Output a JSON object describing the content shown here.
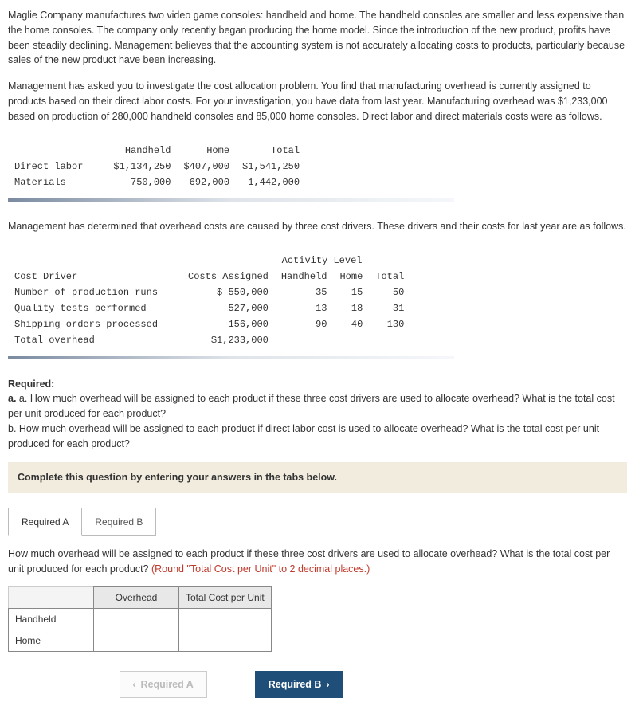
{
  "intro": {
    "p1": "Maglie Company manufactures two video game consoles: handheld and home. The handheld consoles are smaller and less expensive than the home consoles. The company only recently began producing the home model. Since the introduction of the new product, profits have been steadily declining. Management believes that the accounting system is not accurately allocating costs to products, particularly because sales of the new product have been increasing.",
    "p2": "Management has asked you to investigate the cost allocation problem. You find that manufacturing overhead is currently assigned to products based on their direct labor costs. For your investigation, you have data from last year. Manufacturing overhead was $1,233,000 based on production of 280,000 handheld consoles and 85,000 home consoles. Direct labor and direct materials costs were as follows."
  },
  "table1": {
    "headers": {
      "c1": "Handheld",
      "c2": "Home",
      "c3": "Total"
    },
    "rows": [
      {
        "label": "Direct labor",
        "handheld": "$1,134,250",
        "home": "$407,000",
        "total": "$1,541,250"
      },
      {
        "label": "Materials",
        "handheld": "750,000",
        "home": "692,000",
        "total": "1,442,000"
      }
    ]
  },
  "mid": "Management has determined that overhead costs are caused by three cost drivers. These drivers and their costs for last year are as follows.",
  "table2": {
    "superheader": "Activity Level",
    "headers": {
      "driver": "Cost Driver",
      "costs": "Costs Assigned",
      "hh": "Handheld",
      "home": "Home",
      "total": "Total"
    },
    "rows": [
      {
        "driver": "Number of production runs",
        "costs": "$ 550,000",
        "hh": "35",
        "home": "15",
        "total": "50"
      },
      {
        "driver": "Quality tests performed",
        "costs": "527,000",
        "hh": "13",
        "home": "18",
        "total": "31"
      },
      {
        "driver": "Shipping orders processed",
        "costs": "156,000",
        "hh": "90",
        "home": "40",
        "total": "130"
      }
    ],
    "totalrow": {
      "driver": "Total overhead",
      "costs": "$1,233,000"
    }
  },
  "required": {
    "title": "Required:",
    "a": "a. How much overhead will be assigned to each product if these three cost drivers are used to allocate overhead? What is the total cost per unit produced for each product?",
    "b": "b. How much overhead will be assigned to each product if direct labor cost is used to allocate overhead? What is the total cost per unit produced for each product?"
  },
  "instr": "Complete this question by entering your answers in the tabs below.",
  "tabs": {
    "a": "Required A",
    "b": "Required B"
  },
  "tabA": {
    "prompt": "How much overhead will be assigned to each product if these three cost drivers are used to allocate overhead? What is the total cost per unit produced for each product? ",
    "hint": "(Round \"Total Cost per Unit\" to 2 decimal places.)",
    "cols": {
      "c1": "Overhead",
      "c2": "Total Cost per Unit"
    },
    "rows": {
      "r1": "Handheld",
      "r2": "Home"
    }
  },
  "nav": {
    "prev": "Required A",
    "next": "Required B"
  },
  "chart_data": {
    "type": "table",
    "title": "Cost driver activity and assigned overhead",
    "series": [
      {
        "name": "Costs Assigned ($)",
        "categories": [
          "Number of production runs",
          "Quality tests performed",
          "Shipping orders processed",
          "Total overhead"
        ],
        "values": [
          550000,
          527000,
          156000,
          1233000
        ]
      },
      {
        "name": "Handheld activity",
        "categories": [
          "Number of production runs",
          "Quality tests performed",
          "Shipping orders processed"
        ],
        "values": [
          35,
          13,
          90
        ]
      },
      {
        "name": "Home activity",
        "categories": [
          "Number of production runs",
          "Quality tests performed",
          "Shipping orders processed"
        ],
        "values": [
          15,
          18,
          40
        ]
      },
      {
        "name": "Total activity",
        "categories": [
          "Number of production runs",
          "Quality tests performed",
          "Shipping orders processed"
        ],
        "values": [
          50,
          31,
          130
        ]
      }
    ]
  }
}
